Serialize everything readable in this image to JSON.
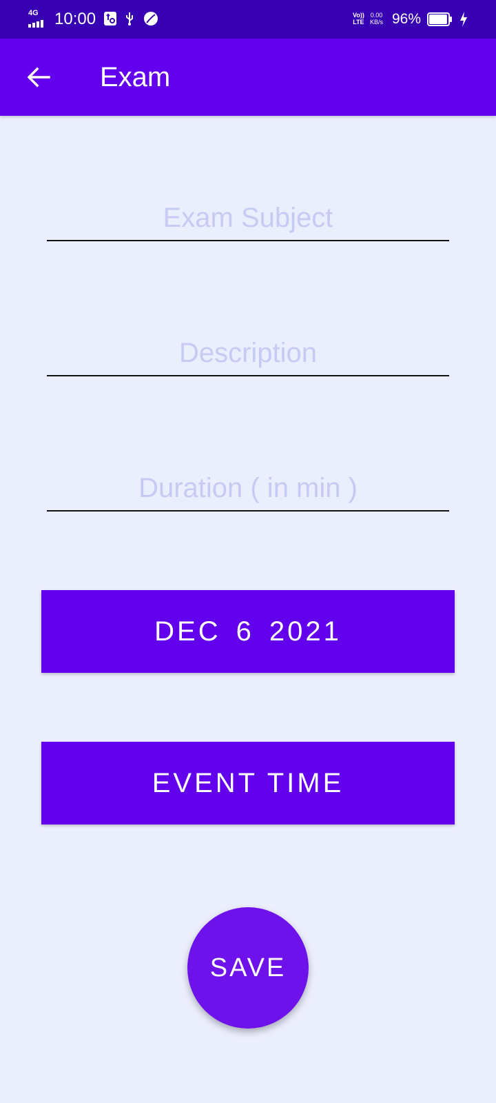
{
  "status_bar": {
    "network": "4G",
    "time": "10:00",
    "volte_line1": "Vo))",
    "volte_line2": "LTE",
    "speed_value": "0.00",
    "speed_unit": "KB/s",
    "battery_percent": "96%",
    "battery_level": 0.96,
    "icons": [
      "signal-icon",
      "usb-debug-icon",
      "usb-icon",
      "leaf-icon",
      "battery-icon",
      "charging-icon"
    ]
  },
  "app_bar": {
    "title": "Exam",
    "back_icon": "arrow-left-icon",
    "background": "#6200ee"
  },
  "form": {
    "subject_placeholder": "Exam Subject",
    "description_placeholder": "Description",
    "duration_placeholder": "Duration ( in min )"
  },
  "date_button": {
    "month": "DEC",
    "day": "6",
    "year": "2021"
  },
  "time_button": {
    "label": "EVENT TIME"
  },
  "save_button": {
    "label": "SAVE"
  },
  "colors": {
    "status_bar": "#3700b3",
    "primary": "#6200ee",
    "background": "#ebeefc",
    "placeholder": "#c6cbf4"
  }
}
